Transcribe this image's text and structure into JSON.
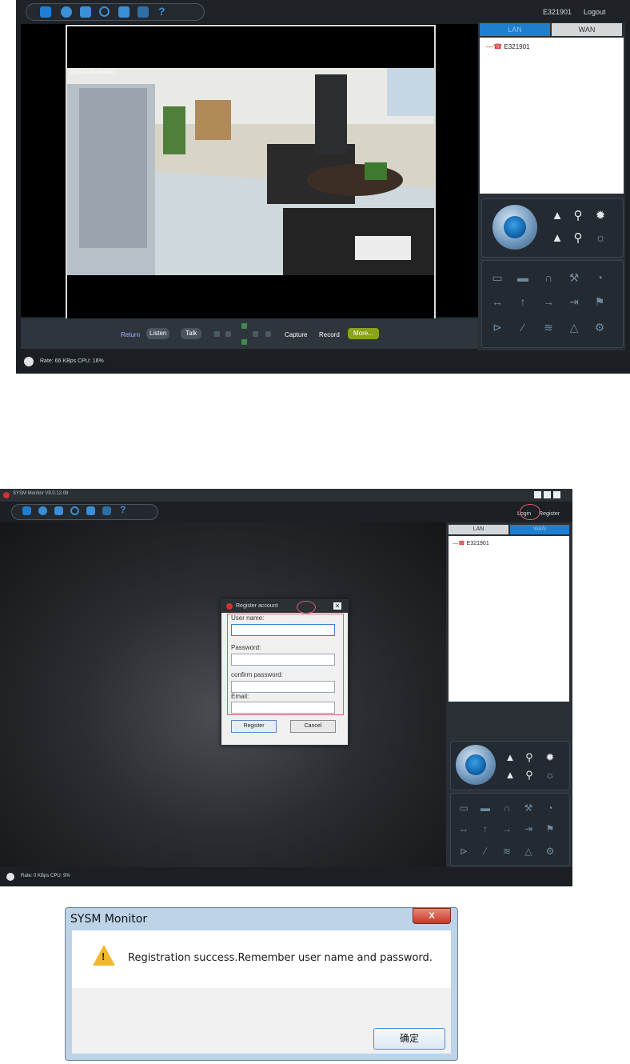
{
  "screen1": {
    "user_label": "E321901",
    "logout_label": "Logout",
    "tabs": [
      "LAN",
      "WAN"
    ],
    "tree_device": "E321901",
    "video_timestamp": "2013-12-16 09:44:52",
    "bottom_buttons": [
      "Return",
      "Listen",
      "Talk",
      "Capture",
      "Record",
      "More..."
    ],
    "status_text": "Rate: 66 KBps  CPU: 16%"
  },
  "screen2": {
    "window_title": "SYSM Monitor  V8.0.12.08",
    "login_label": "Login",
    "register_label": "Register",
    "tabs": [
      "LAN",
      "WAN"
    ],
    "tree_device": "E321901",
    "dialog": {
      "title": "Register account",
      "user_name_label": "User name:",
      "password_label": "Password:",
      "confirm_label": "confirm password:",
      "email_label": "Email:",
      "register_button": "Register",
      "cancel_button": "Cancel"
    },
    "status_text": "Rate: 0 KBps  CPU: 9%"
  },
  "screen3": {
    "title": "SYSM Monitor",
    "close_label": "X",
    "message": "Registration success.Remember user name and password.",
    "ok_label": "确定"
  },
  "icons": {
    "ptz": "ptz-direction-icon",
    "triangle": "warning-triangle-icon"
  },
  "colors": {
    "app_bg": "#1c2024",
    "accent_blue": "#1e7fd0",
    "dialog_highlight": "#e05c6c"
  }
}
